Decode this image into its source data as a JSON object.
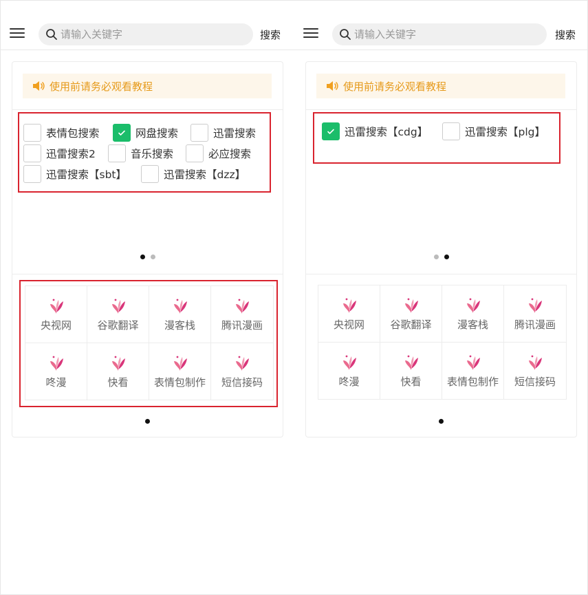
{
  "colors": {
    "accent_green": "#1bbd6a",
    "notice_text": "#e69a1a",
    "notice_bg": "#fdf6ea",
    "highlight_red": "#d9232e"
  },
  "panels": [
    {
      "header": {
        "placeholder": "请输入关键字",
        "search_label": "搜索"
      },
      "notice": "使用前请务必观看教程",
      "checks": [
        {
          "label": "表情包搜索",
          "checked": false
        },
        {
          "label": "网盘搜索",
          "checked": true
        },
        {
          "label": "迅雷搜索",
          "checked": false
        },
        {
          "label": "迅雷搜索2",
          "checked": false
        },
        {
          "label": "音乐搜索",
          "checked": false
        },
        {
          "label": "必应搜索",
          "checked": false
        },
        {
          "label": "迅雷搜索【sbt】",
          "checked": false
        },
        {
          "label": "迅雷搜索【dzz】",
          "checked": false
        }
      ],
      "pager": {
        "pages": 2,
        "active": 1
      },
      "apps": [
        "央视网",
        "谷歌翻译",
        "漫客栈",
        "腾讯漫画",
        "咚漫",
        "快看",
        "表情包制作",
        "短信接码"
      ]
    },
    {
      "header": {
        "placeholder": "请输入关键字",
        "search_label": "搜索"
      },
      "notice": "使用前请务必观看教程",
      "checks": [
        {
          "label": "迅雷搜索【cdg】",
          "checked": true
        },
        {
          "label": "迅雷搜索【plg】",
          "checked": false
        }
      ],
      "pager": {
        "pages": 2,
        "active": 2
      },
      "apps": [
        "央视网",
        "谷歌翻译",
        "漫客栈",
        "腾讯漫画",
        "咚漫",
        "快看",
        "表情包制作",
        "短信接码"
      ]
    }
  ],
  "icons": {
    "menu": "hamburger-icon",
    "search": "magnifier-icon",
    "notice": "speaker-icon",
    "app": "butterfly-icon",
    "check": "checkmark-icon"
  }
}
